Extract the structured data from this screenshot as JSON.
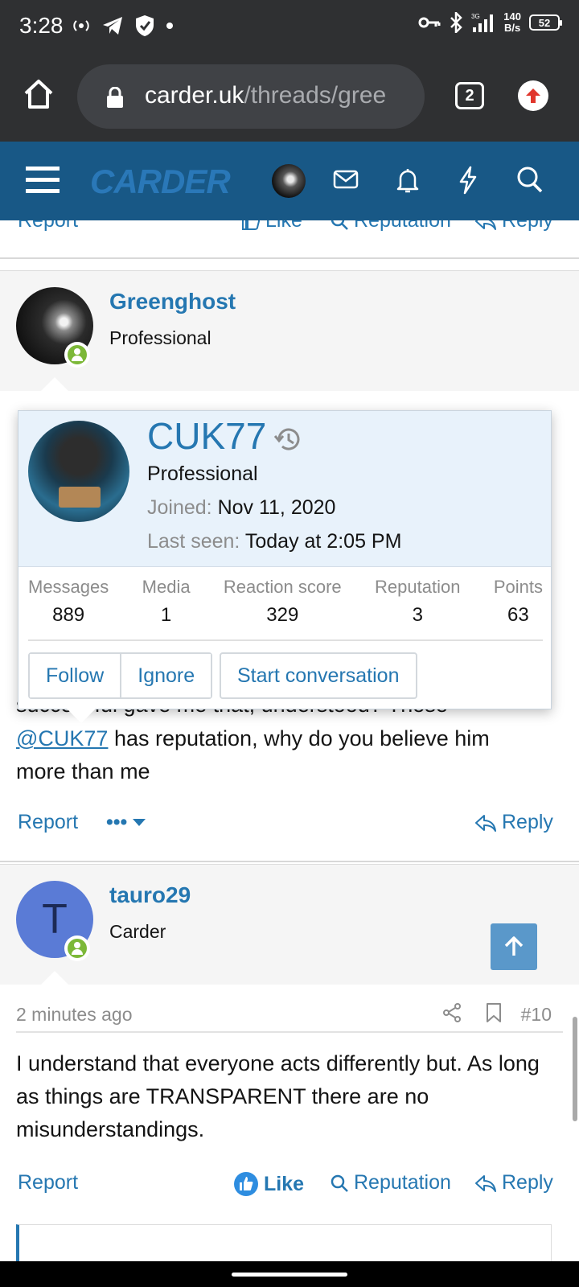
{
  "status_bar": {
    "time": "3:28",
    "speed_value": "140",
    "speed_unit": "B/s",
    "battery": "52"
  },
  "browser": {
    "url_host": "carder.uk",
    "url_path": "/threads/gree",
    "tab_count": "2"
  },
  "site": {
    "logo": "CARDER"
  },
  "top_actions": {
    "report": "Report",
    "like": "Like",
    "reputation": "Reputation",
    "reply": "Reply"
  },
  "post1": {
    "username": "Greenghost",
    "role": "Professional"
  },
  "tooltip": {
    "name": "CUK77",
    "role": "Professional",
    "joined_label": "Joined:",
    "joined_value": "Nov 11, 2020",
    "last_seen_label": "Last seen:",
    "last_seen_value": "Today at 2:05 PM",
    "stats": [
      {
        "label": "Messages",
        "value": "889"
      },
      {
        "label": "Media",
        "value": "1"
      },
      {
        "label": "Reaction score",
        "value": "329"
      },
      {
        "label": "Reputation",
        "value": "3"
      },
      {
        "label": "Points",
        "value": "63"
      }
    ],
    "follow": "Follow",
    "ignore": "Ignore",
    "start_conversation": "Start conversation"
  },
  "post1_text": {
    "partial": "successful gave me that, understood? Those",
    "mention": "@CUK77",
    "rest": " has reputation, why do you believe him",
    "line3": "more than me"
  },
  "post1_actions": {
    "report": "Report",
    "more": "•••",
    "reply": "Reply"
  },
  "post2": {
    "avatar_letter": "T",
    "username": "tauro29",
    "role": "Carder",
    "time": "2 minutes ago",
    "number": "#10",
    "text": "I understand that everyone acts differently but. As long as things are TRANSPARENT there are no misunderstandings.",
    "report": "Report",
    "like": "Like",
    "reputation": "Reputation",
    "reply": "Reply"
  },
  "colors": {
    "accent": "#2577b1",
    "header": "#185886",
    "online": "#7cb838"
  }
}
